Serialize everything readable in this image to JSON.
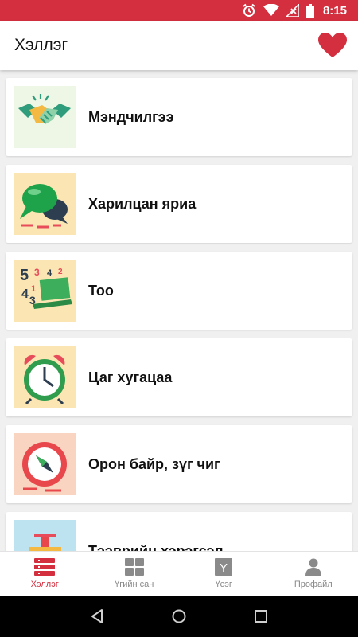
{
  "status_bar": {
    "time": "8:15",
    "icons": [
      "alarm-icon",
      "wifi-icon",
      "signal-icon",
      "battery-icon"
    ]
  },
  "app_bar": {
    "title": "Хэллэг",
    "favorite_icon": "heart-icon",
    "accent": "#d32f3f"
  },
  "categories": [
    {
      "label": "Мэндчилгээ",
      "icon": "handshake-icon"
    },
    {
      "label": "Харилцан яриа",
      "icon": "chat-bubbles-icon"
    },
    {
      "label": "Тоо",
      "icon": "numbers-icon"
    },
    {
      "label": "Цаг хугацаа",
      "icon": "alarm-clock-icon"
    },
    {
      "label": "Орон байр, зүг чиг",
      "icon": "compass-icon"
    },
    {
      "label": "Тээврийн хэрэгсэл",
      "icon": "transport-icon"
    }
  ],
  "bottom_nav": [
    {
      "label": "Хэллэг",
      "icon": "list-icon",
      "active": true
    },
    {
      "label": "Үгийн сан",
      "icon": "grid-icon",
      "active": false
    },
    {
      "label": "Үсэг",
      "icon": "letter-icon",
      "glyph": "Y",
      "active": false
    },
    {
      "label": "Профайл",
      "icon": "person-icon",
      "active": false
    }
  ],
  "system_nav": [
    "back-icon",
    "home-icon",
    "recents-icon"
  ]
}
